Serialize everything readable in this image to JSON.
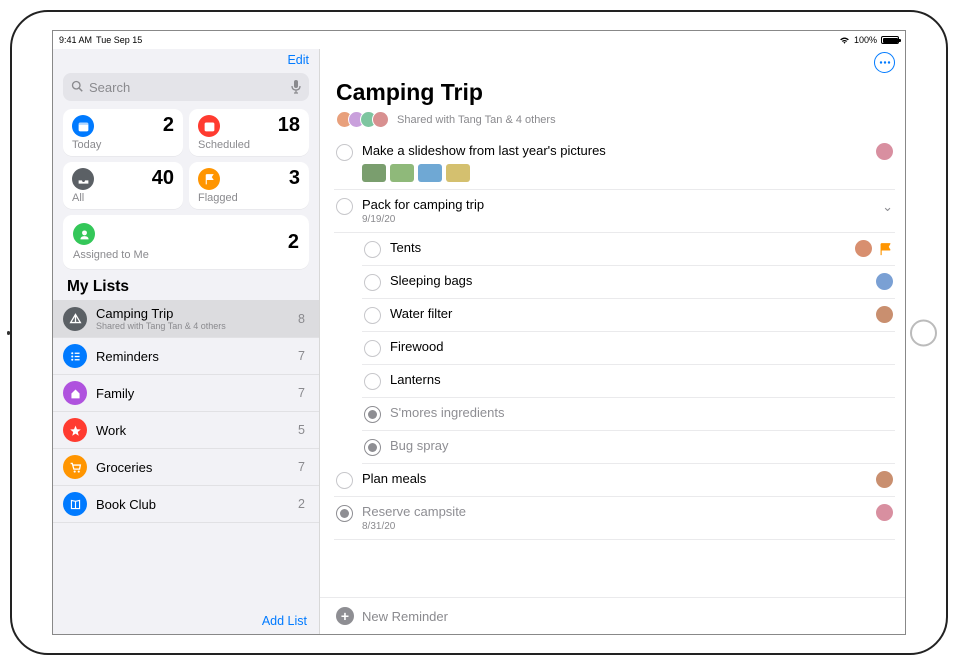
{
  "status": {
    "time": "9:41 AM",
    "date": "Tue Sep 15",
    "battery": "100%"
  },
  "sidebar": {
    "edit": "Edit",
    "search_placeholder": "Search",
    "tiles": {
      "today": {
        "label": "Today",
        "count": "2",
        "color": "#007aff"
      },
      "scheduled": {
        "label": "Scheduled",
        "count": "18",
        "color": "#ff3b30"
      },
      "all": {
        "label": "All",
        "count": "40",
        "color": "#5b6065"
      },
      "flagged": {
        "label": "Flagged",
        "count": "3",
        "color": "#ff9500"
      },
      "assigned": {
        "label": "Assigned to Me",
        "count": "2",
        "color": "#34c759"
      }
    },
    "my_lists_header": "My Lists",
    "lists": [
      {
        "name": "Camping Trip",
        "sub": "Shared with Tang Tan & 4 others",
        "count": "8",
        "color": "#5b6065",
        "selected": true,
        "icon": "tent"
      },
      {
        "name": "Reminders",
        "count": "7",
        "color": "#007aff",
        "icon": "list"
      },
      {
        "name": "Family",
        "count": "7",
        "color": "#af52de",
        "icon": "home"
      },
      {
        "name": "Work",
        "count": "5",
        "color": "#ff3b30",
        "icon": "star"
      },
      {
        "name": "Groceries",
        "count": "7",
        "color": "#ff9500",
        "icon": "cart"
      },
      {
        "name": "Book Club",
        "count": "2",
        "color": "#007aff",
        "icon": "book"
      }
    ],
    "add_list": "Add List"
  },
  "detail": {
    "title": "Camping Trip",
    "shared_label": "Shared with Tang Tan & 4 others",
    "shared_avatars": [
      "#e8a07c",
      "#c9a0dc",
      "#7ec5a0",
      "#d89090"
    ],
    "reminders": [
      {
        "title": "Make a slideshow from last year's pictures",
        "avatar": "#d88fa0",
        "thumbs": [
          "#7a9e6e",
          "#8fb97a",
          "#6fa8d4",
          "#d4c06f"
        ]
      },
      {
        "title": "Pack for camping trip",
        "date": "9/19/20",
        "expandable": true,
        "subtasks": [
          {
            "title": "Tents",
            "avatar": "#d88f6f",
            "flagged": true
          },
          {
            "title": "Sleeping bags",
            "avatar": "#7aa0d4"
          },
          {
            "title": "Water filter",
            "avatar": "#c98f6f"
          },
          {
            "title": "Firewood"
          },
          {
            "title": "Lanterns"
          },
          {
            "title": "S'mores ingredients",
            "done": true
          },
          {
            "title": "Bug spray",
            "done": true
          }
        ]
      },
      {
        "title": "Plan meals",
        "avatar": "#c98f6f"
      },
      {
        "title": "Reserve campsite",
        "date": "8/31/20",
        "done": true,
        "avatar": "#d88fa0"
      }
    ],
    "new_reminder": "New Reminder"
  }
}
